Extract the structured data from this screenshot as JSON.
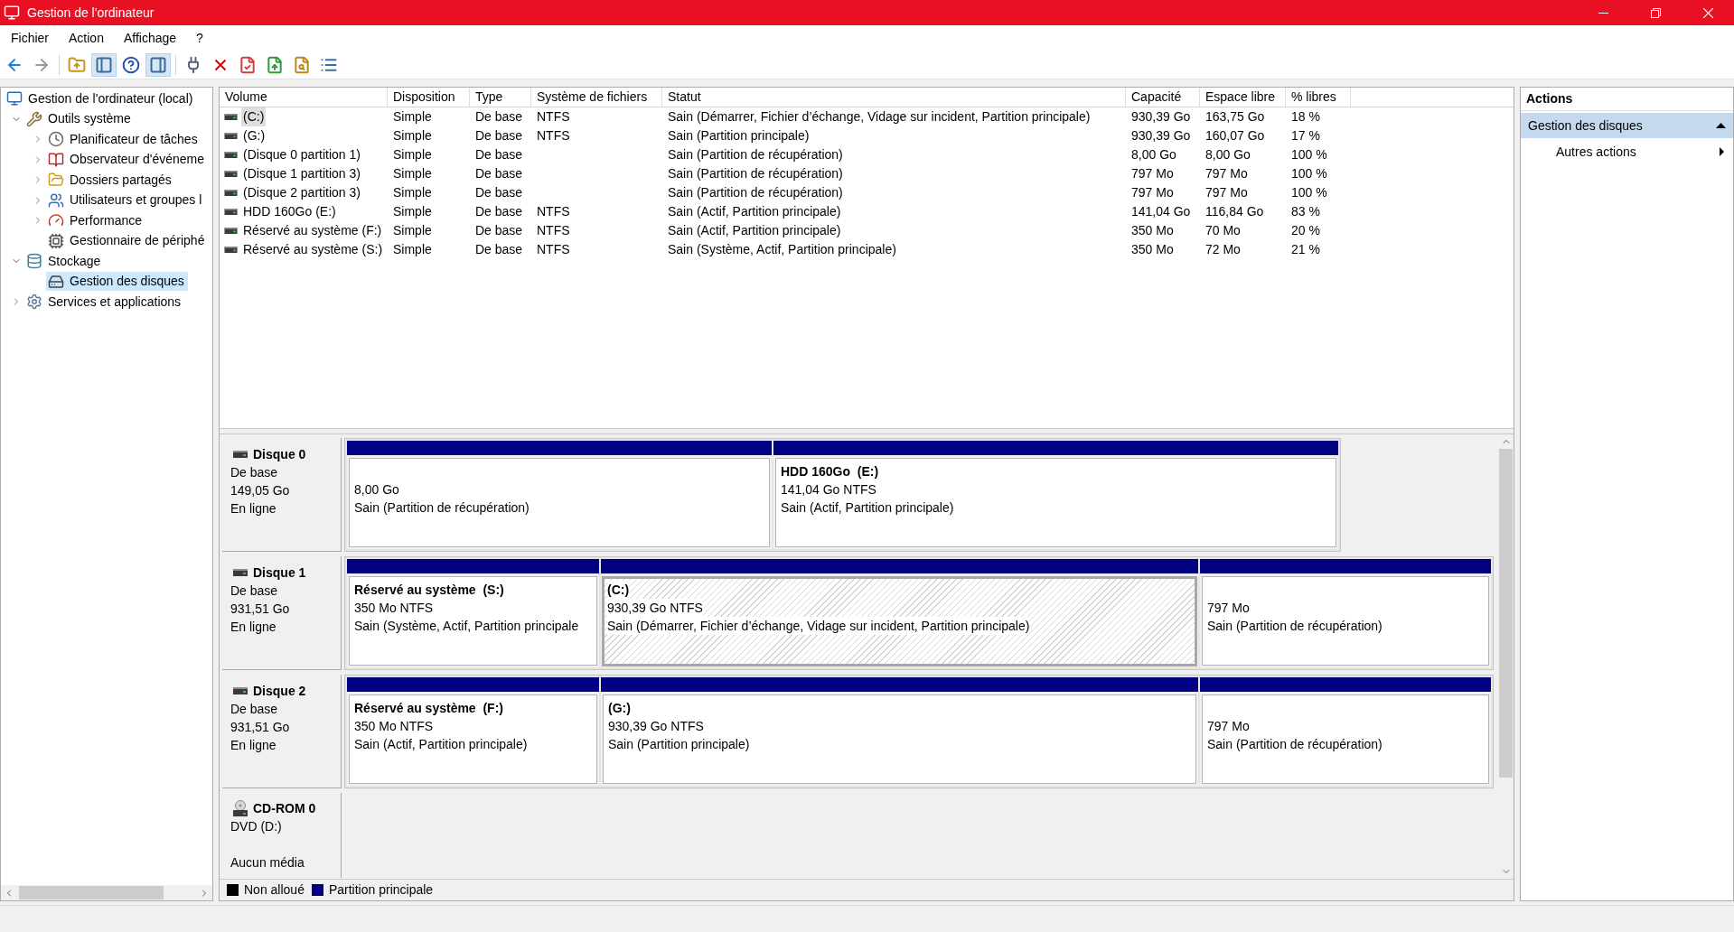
{
  "window": {
    "title": "Gestion de l'ordinateur"
  },
  "menu": [
    {
      "label": "Fichier"
    },
    {
      "label": "Action"
    },
    {
      "label": "Affichage"
    },
    {
      "label": "?"
    }
  ],
  "toolbar": {
    "groups": [
      {
        "buttons": [
          {
            "selected": false,
            "disabled": false
          },
          {
            "selected": false,
            "disabled": true
          }
        ]
      },
      {
        "buttons": [
          {
            "selected": false,
            "disabled": false
          },
          {
            "selected": true,
            "disabled": false
          },
          {
            "selected": false,
            "disabled": false
          },
          {
            "selected": true,
            "disabled": false
          }
        ]
      },
      {
        "buttons": [
          {
            "selected": false,
            "disabled": false
          },
          {
            "selected": false,
            "disabled": false
          },
          {
            "selected": false,
            "disabled": false
          },
          {
            "selected": false,
            "disabled": false
          },
          {
            "selected": false,
            "disabled": false
          },
          {
            "selected": false,
            "disabled": false
          }
        ]
      }
    ]
  },
  "tree": [
    {
      "label": "Gestion de l'ordinateur (local)",
      "selected": false,
      "children": [
        {
          "label": "Outils système",
          "expanded": true,
          "selected": false,
          "children": [
            {
              "label": "Planificateur de tâches",
              "expanded": false,
              "selected": false
            },
            {
              "label": "Observateur d'événeme",
              "expanded": false,
              "selected": false
            },
            {
              "label": "Dossiers partagés",
              "expanded": false,
              "selected": false
            },
            {
              "label": "Utilisateurs et groupes l",
              "expanded": false,
              "selected": false
            },
            {
              "label": "Performance",
              "expanded": false,
              "selected": false
            },
            {
              "label": "Gestionnaire de périphé",
              "selected": false
            }
          ]
        },
        {
          "label": "Stockage",
          "expanded": true,
          "selected": false,
          "children": [
            {
              "label": "Gestion des disques",
              "selected": true
            }
          ]
        },
        {
          "label": "Services et applications",
          "expanded": false,
          "selected": false
        }
      ]
    }
  ],
  "table": {
    "columns": [
      {
        "label": "Volume"
      },
      {
        "label": "Disposition"
      },
      {
        "label": "Type"
      },
      {
        "label": "Système de fichiers"
      },
      {
        "label": "Statut"
      },
      {
        "label": "Capacité"
      },
      {
        "label": "Espace libre"
      },
      {
        "label": "% libres"
      }
    ],
    "rows": [
      {
        "volume": "(C:)",
        "layout": "Simple",
        "type": "De base",
        "file_system": "NTFS",
        "status": "Sain (Démarrer, Fichier d’échange, Vidage sur incident, Partition principale)",
        "capacity": "930,39 Go",
        "free_space": "163,75 Go",
        "percent_free": "18 %",
        "selected": true
      },
      {
        "volume": "(G:)",
        "layout": "Simple",
        "type": "De base",
        "file_system": "NTFS",
        "status": "Sain (Partition principale)",
        "capacity": "930,39 Go",
        "free_space": "160,07 Go",
        "percent_free": "17 %",
        "selected": false
      },
      {
        "volume": "(Disque 0 partition 1)",
        "layout": "Simple",
        "type": "De base",
        "status": "Sain (Partition de récupération)",
        "capacity": "8,00 Go",
        "free_space": "8,00 Go",
        "percent_free": "100 %",
        "selected": false
      },
      {
        "volume": "(Disque 1 partition 3)",
        "layout": "Simple",
        "type": "De base",
        "status": "Sain (Partition de récupération)",
        "capacity": "797 Mo",
        "free_space": "797 Mo",
        "percent_free": "100 %",
        "selected": false
      },
      {
        "volume": "(Disque 2 partition 3)",
        "layout": "Simple",
        "type": "De base",
        "status": "Sain (Partition de récupération)",
        "capacity": "797 Mo",
        "free_space": "797 Mo",
        "percent_free": "100 %",
        "selected": false
      },
      {
        "volume": "HDD 160Go (E:)",
        "layout": "Simple",
        "type": "De base",
        "file_system": "NTFS",
        "status": "Sain (Actif, Partition principale)",
        "capacity": "141,04 Go",
        "free_space": "116,84 Go",
        "percent_free": "83 %",
        "selected": false
      },
      {
        "volume": "Réservé au système (F:)",
        "layout": "Simple",
        "type": "De base",
        "file_system": "NTFS",
        "status": "Sain (Actif, Partition principale)",
        "capacity": "350 Mo",
        "free_space": "70 Mo",
        "percent_free": "20 %",
        "selected": false
      },
      {
        "volume": "Réservé au système (S:)",
        "layout": "Simple",
        "type": "De base",
        "file_system": "NTFS",
        "status": "Sain (Système, Actif, Partition principale)",
        "capacity": "350 Mo",
        "free_space": "72 Mo",
        "percent_free": "21 %",
        "selected": false
      }
    ]
  },
  "disk_map": {
    "disks": [
      {
        "kind": "disk",
        "name": "Disque 0",
        "type": "De base",
        "size": "149,05 Go",
        "status": "En ligne",
        "partitions": [
          {
            "size": "8,00 Go",
            "status": "Sain (Partition de récupération)",
            "selected": false
          },
          {
            "title": "HDD 160Go  (E:)",
            "size": "141,04 Go NTFS",
            "status": "Sain (Actif, Partition principale)",
            "selected": false
          }
        ]
      },
      {
        "kind": "disk",
        "name": "Disque 1",
        "type": "De base",
        "size": "931,51 Go",
        "status": "En ligne",
        "partitions": [
          {
            "title": "Réservé au système  (S:)",
            "size": "350 Mo NTFS",
            "status": "Sain (Système, Actif, Partition principale",
            "selected": false
          },
          {
            "title": "(C:)",
            "size": "930,39 Go NTFS",
            "status": "Sain (Démarrer, Fichier d’échange, Vidage sur incident, Partition principale)",
            "selected": true
          },
          {
            "size": "797 Mo",
            "status": "Sain (Partition de récupération)",
            "selected": false
          }
        ]
      },
      {
        "kind": "disk",
        "name": "Disque 2",
        "type": "De base",
        "size": "931,51 Go",
        "status": "En ligne",
        "partitions": [
          {
            "title": "Réservé au système  (F:)",
            "size": "350 Mo NTFS",
            "status": "Sain (Actif, Partition principale)",
            "selected": false
          },
          {
            "title": "(G:)",
            "size": "930,39 Go NTFS",
            "status": "Sain (Partition principale)",
            "selected": false
          },
          {
            "size": "797 Mo",
            "status": "Sain (Partition de récupération)",
            "selected": false
          }
        ]
      },
      {
        "kind": "cdrom",
        "name": "CD-ROM 0",
        "type": "DVD (D:)",
        "status": "Aucun média"
      }
    ],
    "legend": [
      {
        "label": "Non alloué",
        "color": "#000000"
      },
      {
        "label": "Partition principale",
        "color": "#000080"
      }
    ]
  },
  "actions": {
    "title": "Actions",
    "sections": [
      {
        "label": "Gestion des disques",
        "expanded": true,
        "items": [
          {
            "label": "Autres actions",
            "submenu": true
          }
        ]
      }
    ]
  }
}
